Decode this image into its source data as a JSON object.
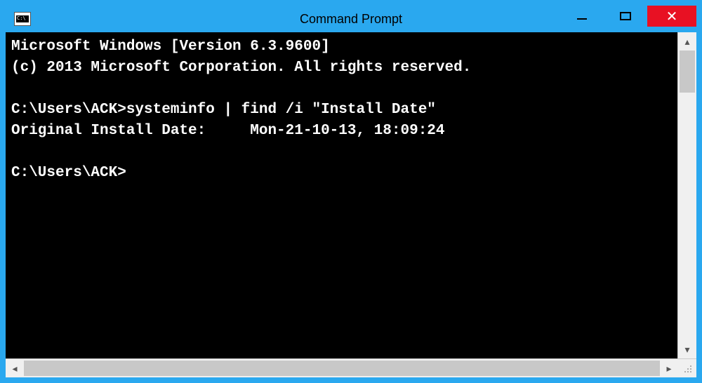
{
  "window": {
    "title": "Command Prompt"
  },
  "console": {
    "lines": [
      "Microsoft Windows [Version 6.3.9600]",
      "(c) 2013 Microsoft Corporation. All rights reserved.",
      "",
      "C:\\Users\\ACK>systeminfo | find /i \"Install Date\"",
      "Original Install Date:     Mon-21-10-13, 18:09:24",
      "",
      "C:\\Users\\ACK>"
    ]
  },
  "icons": {
    "minimize": "minimize",
    "maximize": "maximize",
    "close": "✕",
    "up": "▴",
    "down": "▾",
    "left": "◂",
    "right": "▸"
  }
}
